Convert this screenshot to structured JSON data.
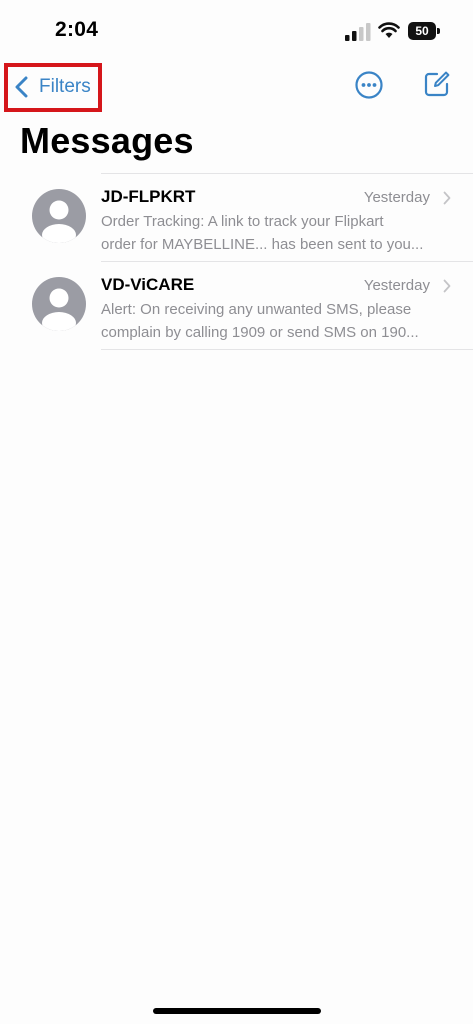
{
  "status_bar": {
    "time": "2:04",
    "battery_level": "50"
  },
  "nav": {
    "back_label": "Filters",
    "more_icon": "ellipsis-circle-icon",
    "compose_icon": "compose-icon"
  },
  "page_title": "Messages",
  "conversations": [
    {
      "sender": "JD-FLPKRT",
      "time": "Yesterday",
      "preview_line1": "Order Tracking: A link to track your Flipkart",
      "preview_line2": "order for MAYBELLINE... has been sent to you..."
    },
    {
      "sender": "VD-ViCARE",
      "time": "Yesterday",
      "preview_line1": "Alert: On receiving any unwanted SMS, please",
      "preview_line2": "complain by calling 1909 or send SMS on 190..."
    }
  ],
  "colors": {
    "accent": "#3a84c6",
    "highlight_box": "#d5161b",
    "secondary_text": "#8e8e93"
  }
}
